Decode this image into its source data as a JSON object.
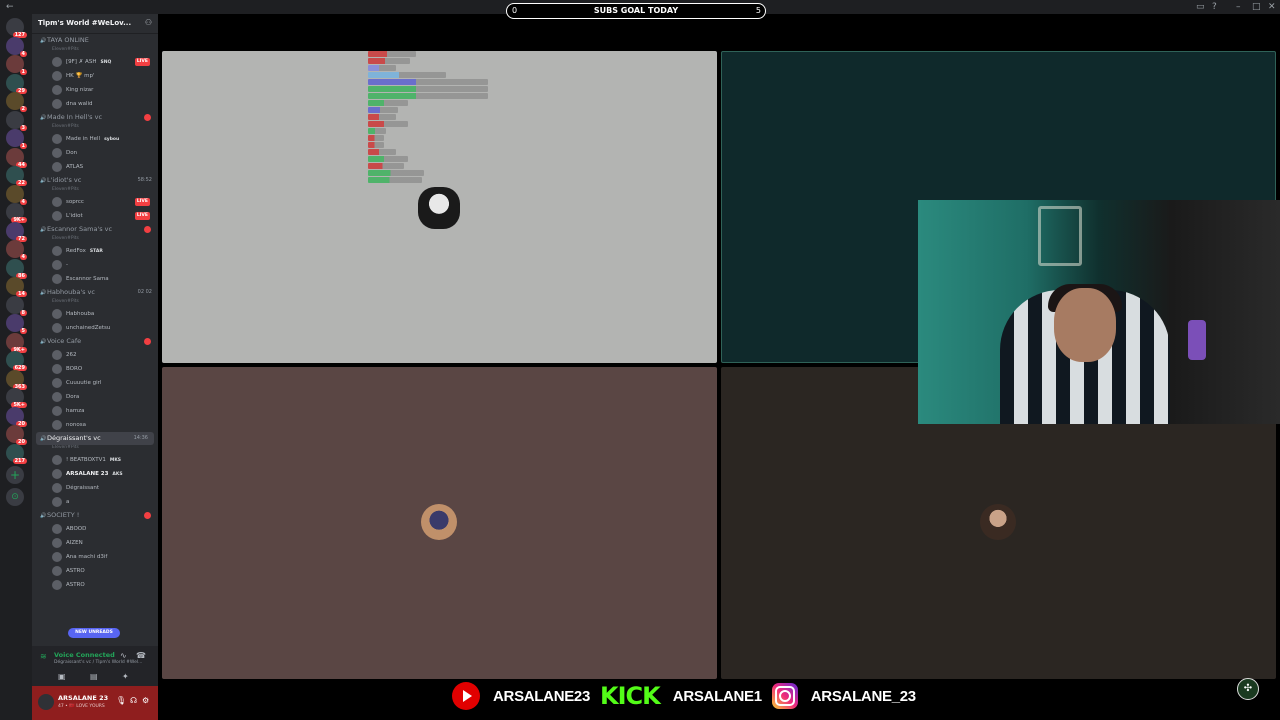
{
  "goal": {
    "label": "SUBS GOAL TODAY",
    "current": "0",
    "target": "5"
  },
  "server": {
    "name": "Tlpm's World #WeLov...",
    "badges": [
      "127",
      "4",
      "1",
      "29",
      "2",
      "3",
      "1",
      "44",
      "22",
      "4",
      "9K+",
      "72",
      "4",
      "86",
      "14",
      "8",
      "5",
      "9K+",
      "629",
      "363",
      "5K+",
      "20",
      "20",
      "217"
    ]
  },
  "channels": [
    {
      "name": "TAYA ONLINE",
      "sub": "Eleven#Pits",
      "users": [
        {
          "name": "[9F] ✗ ASH",
          "tag": "SNQ",
          "live": true
        },
        {
          "name": "HK 🏆 mp'",
          "live": false
        },
        {
          "name": "King nizar",
          "live": false
        },
        {
          "name": "dna walid",
          "live": false
        }
      ]
    },
    {
      "name": "Made In Hell's vc",
      "sub": "Eleven#Pits",
      "dot": true,
      "users": [
        {
          "name": "Made in Hell",
          "tag": "sybou",
          "live": false
        },
        {
          "name": "Don",
          "live": false
        },
        {
          "name": "ATLAS",
          "live": false
        }
      ]
    },
    {
      "name": "L'idiot's vc",
      "sub": "Eleven#Pits",
      "time": "58:52",
      "users": [
        {
          "name": "soprcc",
          "live": true
        },
        {
          "name": "L'idiot",
          "live": true
        }
      ]
    },
    {
      "name": "Escannor Sama's vc",
      "sub": "Eleven#Pits",
      "dot": true,
      "users": [
        {
          "name": "RedFox",
          "tag": "STAR",
          "live": false
        },
        {
          "name": "-",
          "live": false
        },
        {
          "name": "Escannor Sama",
          "live": false
        }
      ]
    },
    {
      "name": "Habhouba's vc",
      "sub": "Eleven#Pits",
      "time": "02 02",
      "users": [
        {
          "name": "Habhouba",
          "live": false
        },
        {
          "name": "unchainedZetsu",
          "live": false
        }
      ]
    },
    {
      "name": "Voice Cafe",
      "sub": "",
      "dot": true,
      "users": [
        {
          "name": "262",
          "live": false
        },
        {
          "name": "BORO",
          "live": false
        },
        {
          "name": "Cuuuutie girl",
          "live": false
        },
        {
          "name": "Dora",
          "live": false
        },
        {
          "name": "hamza",
          "live": false
        },
        {
          "name": "nonosa",
          "live": false
        }
      ]
    },
    {
      "name": "Dégraissant's vc",
      "sub": "Eleven#Pits",
      "time": "14:36",
      "active": true,
      "users": [
        {
          "name": "! BEATBOXTV1",
          "tag": "MKS",
          "live": false
        },
        {
          "name": "ARSALANE 23",
          "tag": "AKS",
          "live": false,
          "bold": true
        },
        {
          "name": "Dégraissant",
          "live": false
        },
        {
          "name": "a",
          "live": false
        }
      ]
    },
    {
      "name": "SOCIETY !",
      "sub": "",
      "dot": true,
      "users": [
        {
          "name": "ABOOD",
          "live": false
        },
        {
          "name": "AIZEN",
          "live": false
        },
        {
          "name": "Ana machi d3if",
          "live": false
        },
        {
          "name": "ASTRO",
          "live": false
        },
        {
          "name": "ASTRO",
          "live": false
        }
      ]
    }
  ],
  "unreads_label": "NEW UNREADS",
  "voice": {
    "status": "Voice Connected",
    "detail": "Dégraissant's vc / Tlpm's World #Wel..."
  },
  "me": {
    "name": "ARSALANE 23",
    "status": "47 • 🇲🇦 LOVE YOURS"
  },
  "socials": [
    {
      "platform": "youtube",
      "handle": "ARSALANE23"
    },
    {
      "platform": "kick",
      "label": "KICK",
      "handle": "ARSALANE1"
    },
    {
      "platform": "instagram",
      "handle": "ARSALANE_23"
    }
  ],
  "colors": {
    "sidebar": "#2b2d31",
    "rail": "#1e1f22",
    "kick": "#53fc18",
    "youtube": "#e10000",
    "live": "#f23f42"
  }
}
